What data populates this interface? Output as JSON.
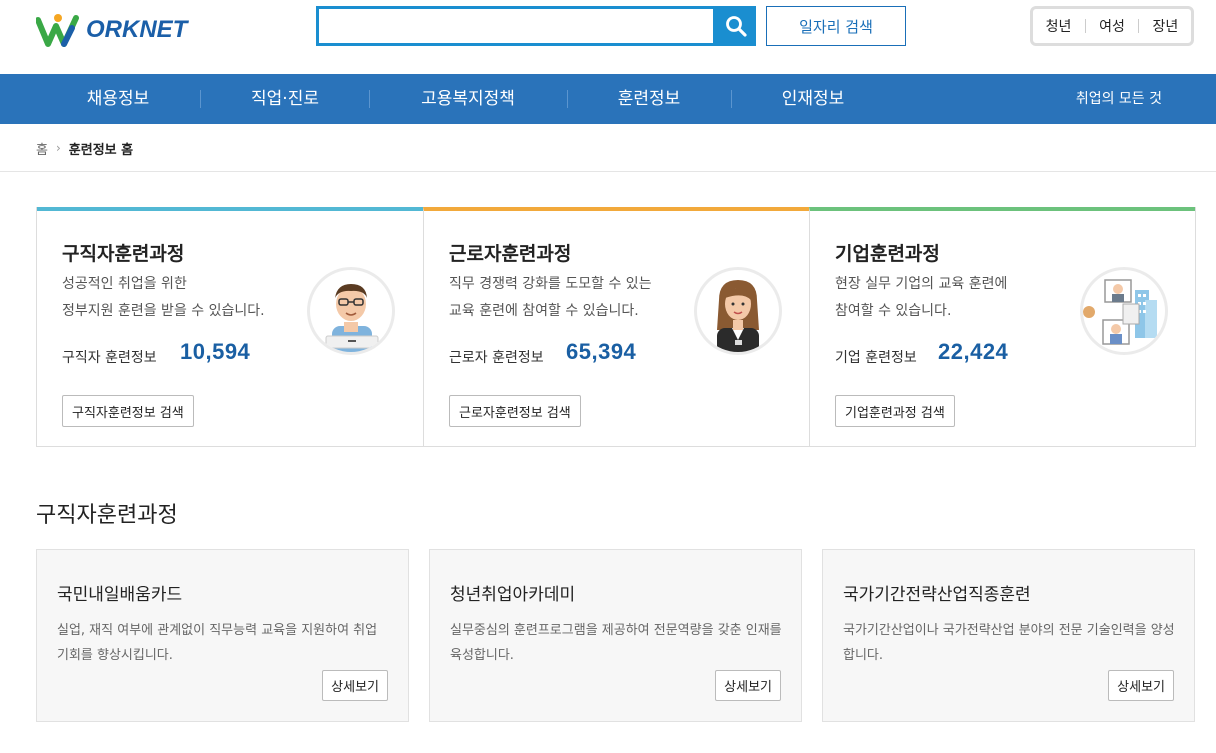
{
  "header": {
    "logo_text": "ORKNET",
    "search": {
      "value": "",
      "placeholder": ""
    },
    "job_search_label": "일자리 검색",
    "audience": [
      "청년",
      "여성",
      "장년"
    ]
  },
  "nav": {
    "items": [
      "채용정보",
      "직업·진로",
      "고용복지정책",
      "훈련정보",
      "인재정보"
    ],
    "right_label": "취업의 모든 것"
  },
  "breadcrumb": {
    "home": "홈",
    "current": "훈련정보 홈"
  },
  "cards": [
    {
      "title": "구직자훈련과정",
      "desc_line1": "성공적인 취업을 위한",
      "desc_line2": "정부지원 훈련을 받을 수 있습니다.",
      "count_label": "구직자 훈련정보",
      "count": "10,594",
      "button": "구직자훈련정보 검색",
      "accent": "#52b8d4"
    },
    {
      "title": "근로자훈련과정",
      "desc_line1": "직무 경쟁력 강화를 도모할 수 있는",
      "desc_line2": "교육 훈련에 참여할 수 있습니다.",
      "count_label": "근로자 훈련정보",
      "count": "65,394",
      "button": "근로자훈련정보 검색",
      "accent": "#f2a93b"
    },
    {
      "title": "기업훈련과정",
      "desc_line1": "현장 실무 기업의 교육 훈련에",
      "desc_line2": "참여할 수 있습니다.",
      "count_label": "기업 훈련정보",
      "count": "22,424",
      "button": "기업훈련과정 검색",
      "accent": "#6cc27c"
    }
  ],
  "section": {
    "title": "구직자훈련과정",
    "programs": [
      {
        "title": "국민내일배움카드",
        "desc": "실업, 재직 여부에 관계없이 직무능력 교육을 지원하여 취업 기회를 향상시킵니다.",
        "button": "상세보기"
      },
      {
        "title": "청년취업아카데미",
        "desc": "실무중심의 훈련프로그램을 제공하여 전문역량을 갖춘 인재를 육성합니다.",
        "button": "상세보기"
      },
      {
        "title": "국가기간전략산업직종훈련",
        "desc": "국가기간산업이나 국가전략산업 분야의 전문 기술인력을 양성합니다.",
        "button": "상세보기"
      }
    ]
  }
}
